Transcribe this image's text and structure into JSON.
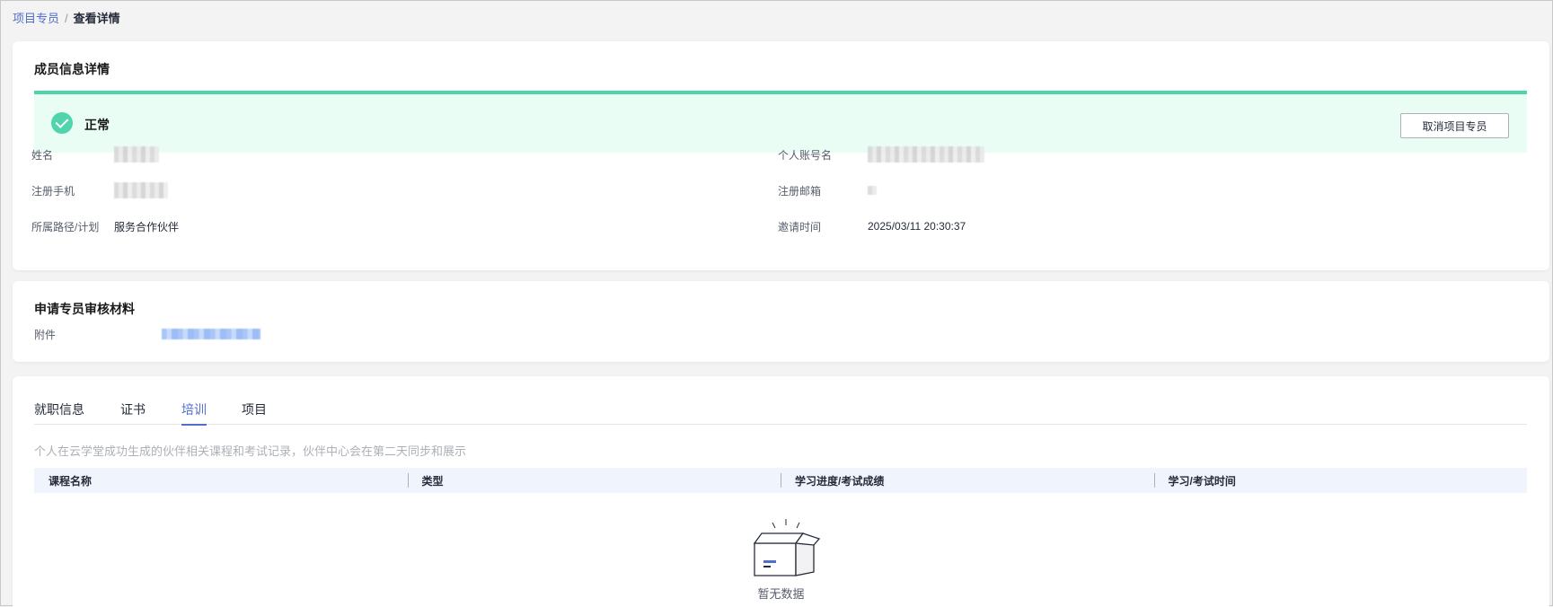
{
  "breadcrumb": {
    "parent": "项目专员",
    "separator": "/",
    "current": "查看详情"
  },
  "member_info": {
    "title": "成员信息详情",
    "status": {
      "text": "正常",
      "icon": "check-circle-icon",
      "color": "#50d4ab"
    },
    "cancel_button": "取消项目专员",
    "fields": {
      "name_label": "姓名",
      "account_label": "个人账号名",
      "phone_label": "注册手机",
      "email_label": "注册邮箱",
      "path_label": "所属路径/计划",
      "path_value": "服务合作伙伴",
      "invite_time_label": "邀请时间",
      "invite_time_value": "2025/03/11 20:30:37"
    }
  },
  "materials": {
    "title": "申请专员审核材料",
    "attachment_label": "附件"
  },
  "detail_tabs": {
    "tabs": [
      {
        "label": "就职信息",
        "active": false
      },
      {
        "label": "证书",
        "active": false
      },
      {
        "label": "培训",
        "active": true
      },
      {
        "label": "项目",
        "active": false
      }
    ],
    "hint": "个人在云学堂成功生成的伙伴相关课程和考试记录，伙伴中心会在第二天同步和展示",
    "columns": [
      "课程名称",
      "类型",
      "学习进度/考试成绩",
      "学习/考试时间"
    ],
    "empty_text": "暂无数据"
  },
  "colors": {
    "accent": "#526ecc",
    "success": "#50d4ab",
    "header_bg": "#f0f4fc"
  }
}
